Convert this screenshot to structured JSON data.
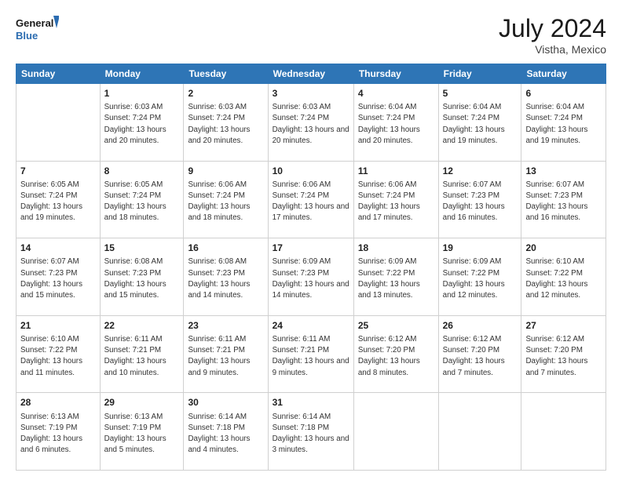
{
  "header": {
    "logo_line1": "General",
    "logo_line2": "Blue",
    "month": "July 2024",
    "location": "Vistha, Mexico"
  },
  "weekdays": [
    "Sunday",
    "Monday",
    "Tuesday",
    "Wednesday",
    "Thursday",
    "Friday",
    "Saturday"
  ],
  "weeks": [
    [
      {
        "day": "",
        "sunrise": "",
        "sunset": "",
        "daylight": ""
      },
      {
        "day": "1",
        "sunrise": "Sunrise: 6:03 AM",
        "sunset": "Sunset: 7:24 PM",
        "daylight": "Daylight: 13 hours and 20 minutes."
      },
      {
        "day": "2",
        "sunrise": "Sunrise: 6:03 AM",
        "sunset": "Sunset: 7:24 PM",
        "daylight": "Daylight: 13 hours and 20 minutes."
      },
      {
        "day": "3",
        "sunrise": "Sunrise: 6:03 AM",
        "sunset": "Sunset: 7:24 PM",
        "daylight": "Daylight: 13 hours and 20 minutes."
      },
      {
        "day": "4",
        "sunrise": "Sunrise: 6:04 AM",
        "sunset": "Sunset: 7:24 PM",
        "daylight": "Daylight: 13 hours and 20 minutes."
      },
      {
        "day": "5",
        "sunrise": "Sunrise: 6:04 AM",
        "sunset": "Sunset: 7:24 PM",
        "daylight": "Daylight: 13 hours and 19 minutes."
      },
      {
        "day": "6",
        "sunrise": "Sunrise: 6:04 AM",
        "sunset": "Sunset: 7:24 PM",
        "daylight": "Daylight: 13 hours and 19 minutes."
      }
    ],
    [
      {
        "day": "7",
        "sunrise": "Sunrise: 6:05 AM",
        "sunset": "Sunset: 7:24 PM",
        "daylight": "Daylight: 13 hours and 19 minutes."
      },
      {
        "day": "8",
        "sunrise": "Sunrise: 6:05 AM",
        "sunset": "Sunset: 7:24 PM",
        "daylight": "Daylight: 13 hours and 18 minutes."
      },
      {
        "day": "9",
        "sunrise": "Sunrise: 6:06 AM",
        "sunset": "Sunset: 7:24 PM",
        "daylight": "Daylight: 13 hours and 18 minutes."
      },
      {
        "day": "10",
        "sunrise": "Sunrise: 6:06 AM",
        "sunset": "Sunset: 7:24 PM",
        "daylight": "Daylight: 13 hours and 17 minutes."
      },
      {
        "day": "11",
        "sunrise": "Sunrise: 6:06 AM",
        "sunset": "Sunset: 7:24 PM",
        "daylight": "Daylight: 13 hours and 17 minutes."
      },
      {
        "day": "12",
        "sunrise": "Sunrise: 6:07 AM",
        "sunset": "Sunset: 7:23 PM",
        "daylight": "Daylight: 13 hours and 16 minutes."
      },
      {
        "day": "13",
        "sunrise": "Sunrise: 6:07 AM",
        "sunset": "Sunset: 7:23 PM",
        "daylight": "Daylight: 13 hours and 16 minutes."
      }
    ],
    [
      {
        "day": "14",
        "sunrise": "Sunrise: 6:07 AM",
        "sunset": "Sunset: 7:23 PM",
        "daylight": "Daylight: 13 hours and 15 minutes."
      },
      {
        "day": "15",
        "sunrise": "Sunrise: 6:08 AM",
        "sunset": "Sunset: 7:23 PM",
        "daylight": "Daylight: 13 hours and 15 minutes."
      },
      {
        "day": "16",
        "sunrise": "Sunrise: 6:08 AM",
        "sunset": "Sunset: 7:23 PM",
        "daylight": "Daylight: 13 hours and 14 minutes."
      },
      {
        "day": "17",
        "sunrise": "Sunrise: 6:09 AM",
        "sunset": "Sunset: 7:23 PM",
        "daylight": "Daylight: 13 hours and 14 minutes."
      },
      {
        "day": "18",
        "sunrise": "Sunrise: 6:09 AM",
        "sunset": "Sunset: 7:22 PM",
        "daylight": "Daylight: 13 hours and 13 minutes."
      },
      {
        "day": "19",
        "sunrise": "Sunrise: 6:09 AM",
        "sunset": "Sunset: 7:22 PM",
        "daylight": "Daylight: 13 hours and 12 minutes."
      },
      {
        "day": "20",
        "sunrise": "Sunrise: 6:10 AM",
        "sunset": "Sunset: 7:22 PM",
        "daylight": "Daylight: 13 hours and 12 minutes."
      }
    ],
    [
      {
        "day": "21",
        "sunrise": "Sunrise: 6:10 AM",
        "sunset": "Sunset: 7:22 PM",
        "daylight": "Daylight: 13 hours and 11 minutes."
      },
      {
        "day": "22",
        "sunrise": "Sunrise: 6:11 AM",
        "sunset": "Sunset: 7:21 PM",
        "daylight": "Daylight: 13 hours and 10 minutes."
      },
      {
        "day": "23",
        "sunrise": "Sunrise: 6:11 AM",
        "sunset": "Sunset: 7:21 PM",
        "daylight": "Daylight: 13 hours and 9 minutes."
      },
      {
        "day": "24",
        "sunrise": "Sunrise: 6:11 AM",
        "sunset": "Sunset: 7:21 PM",
        "daylight": "Daylight: 13 hours and 9 minutes."
      },
      {
        "day": "25",
        "sunrise": "Sunrise: 6:12 AM",
        "sunset": "Sunset: 7:20 PM",
        "daylight": "Daylight: 13 hours and 8 minutes."
      },
      {
        "day": "26",
        "sunrise": "Sunrise: 6:12 AM",
        "sunset": "Sunset: 7:20 PM",
        "daylight": "Daylight: 13 hours and 7 minutes."
      },
      {
        "day": "27",
        "sunrise": "Sunrise: 6:12 AM",
        "sunset": "Sunset: 7:20 PM",
        "daylight": "Daylight: 13 hours and 7 minutes."
      }
    ],
    [
      {
        "day": "28",
        "sunrise": "Sunrise: 6:13 AM",
        "sunset": "Sunset: 7:19 PM",
        "daylight": "Daylight: 13 hours and 6 minutes."
      },
      {
        "day": "29",
        "sunrise": "Sunrise: 6:13 AM",
        "sunset": "Sunset: 7:19 PM",
        "daylight": "Daylight: 13 hours and 5 minutes."
      },
      {
        "day": "30",
        "sunrise": "Sunrise: 6:14 AM",
        "sunset": "Sunset: 7:18 PM",
        "daylight": "Daylight: 13 hours and 4 minutes."
      },
      {
        "day": "31",
        "sunrise": "Sunrise: 6:14 AM",
        "sunset": "Sunset: 7:18 PM",
        "daylight": "Daylight: 13 hours and 3 minutes."
      },
      {
        "day": "",
        "sunrise": "",
        "sunset": "",
        "daylight": ""
      },
      {
        "day": "",
        "sunrise": "",
        "sunset": "",
        "daylight": ""
      },
      {
        "day": "",
        "sunrise": "",
        "sunset": "",
        "daylight": ""
      }
    ]
  ]
}
